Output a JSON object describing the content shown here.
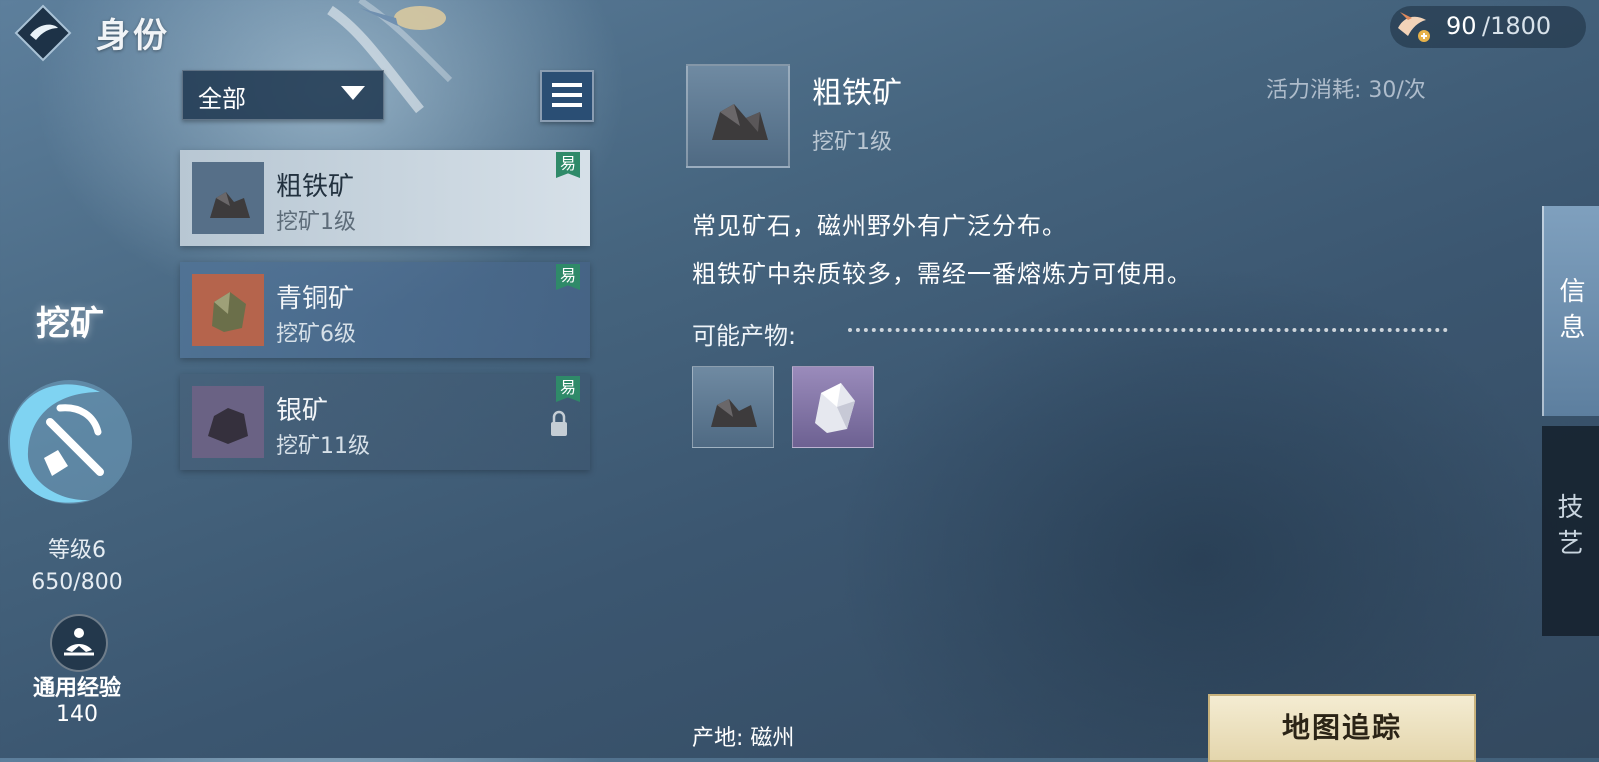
{
  "header": {
    "title": "身份"
  },
  "energy": {
    "current": "90",
    "max": "/1800"
  },
  "skill": {
    "name": "挖矿",
    "level": "等级6",
    "exp": "650/800",
    "common_exp_label": "通用经验",
    "common_exp_value": "140"
  },
  "filter": {
    "label": "全部"
  },
  "list": {
    "items": [
      {
        "name": "粗铁矿",
        "sub": "挖矿1级",
        "badge": "易"
      },
      {
        "name": "青铜矿",
        "sub": "挖矿6级",
        "badge": "易"
      },
      {
        "name": "银矿",
        "sub": "挖矿11级",
        "badge": "易"
      }
    ]
  },
  "detail": {
    "name": "粗铁矿",
    "sub": "挖矿1级",
    "cost": "活力消耗: 30/次",
    "desc1": "常见矿石，磁州野外有广泛分布。",
    "desc2": "粗铁矿中杂质较多，需经一番熔炼方可使用。",
    "products_label": "可能产物:",
    "origin": "产地: 磁州",
    "track_button": "地图追踪"
  },
  "tabs": {
    "info": [
      "信",
      "息"
    ],
    "skill": [
      "技",
      "艺"
    ]
  },
  "colors": {
    "badge": "#2f8a69",
    "track_button": "#efe5c6",
    "selected_item": "#c8d5df"
  }
}
